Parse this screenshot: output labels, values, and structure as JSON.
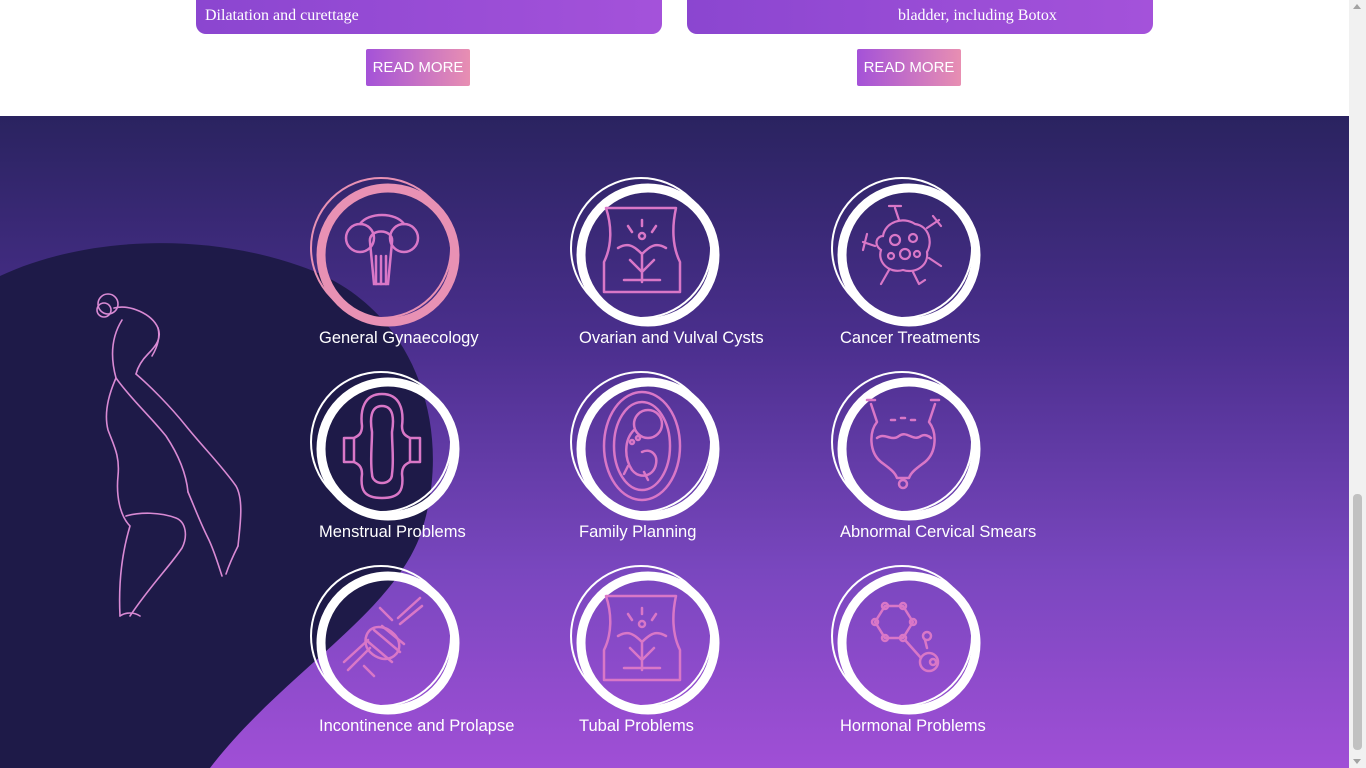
{
  "cards": [
    {
      "text": "Dilatation and curettage",
      "button": "READ MORE"
    },
    {
      "text": "bladder, including Botox",
      "button": "READ MORE"
    }
  ],
  "services": [
    {
      "label": "General Gynaecology",
      "icon": "uterus-icon"
    },
    {
      "label": "Ovarian and Vulval Cysts",
      "icon": "pelvis-icon"
    },
    {
      "label": "Cancer Treatments",
      "icon": "cancer-cell-icon"
    },
    {
      "label": "Menstrual Problems",
      "icon": "sanitary-pad-icon"
    },
    {
      "label": "Family Planning",
      "icon": "fetus-icon"
    },
    {
      "label": "Abnormal Cervical Smears",
      "icon": "bladder-icon"
    },
    {
      "label": "Incontinence and Prolapse",
      "icon": "knot-icon"
    },
    {
      "label": "Tubal Problems",
      "icon": "pelvis-icon"
    },
    {
      "label": "Hormonal Problems",
      "icon": "hormone-molecule-icon"
    }
  ],
  "colors": {
    "card_purple": "#a452da",
    "button_gradient_start": "#a452d8",
    "button_gradient_end": "#e88fb2",
    "section_top": "#2a2360",
    "section_bottom": "#a04fd6",
    "blob": "#1e1a48",
    "icon_pink": "#e891b4",
    "ring_white": "#ffffff"
  }
}
